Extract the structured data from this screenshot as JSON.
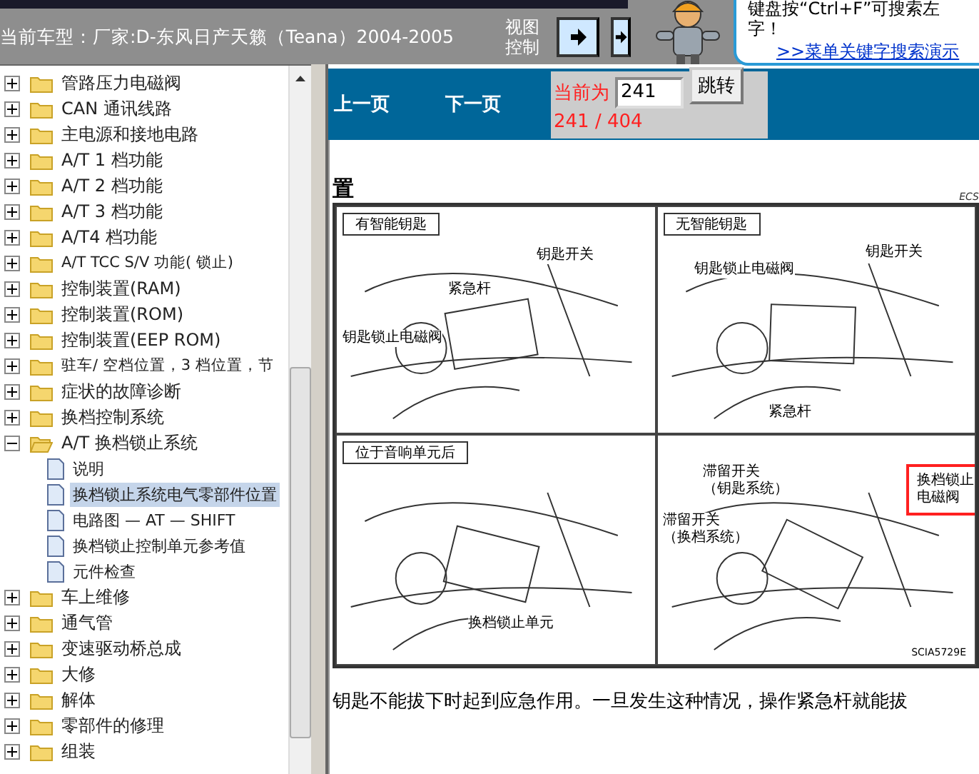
{
  "header": {
    "model_label": "当前车型：厂家:D-东风日产天籁（Teana）2004-2005",
    "view_control": [
      "视图",
      "控制"
    ],
    "tip_text": [
      "键盘按“Ctrl+F”可搜索左",
      "字！"
    ],
    "tip_link": ">>菜单关键字搜索演示"
  },
  "tree": [
    {
      "label": "管路压力电磁阀",
      "expanded": false
    },
    {
      "label": "CAN 通讯线路",
      "expanded": false
    },
    {
      "label": "主电源和接地电路",
      "expanded": false
    },
    {
      "label": "A/T 1 档功能",
      "expanded": false
    },
    {
      "label": "A/T 2 档功能",
      "expanded": false
    },
    {
      "label": "A/T 3 档功能",
      "expanded": false
    },
    {
      "label": "A/T4 档功能",
      "expanded": false
    },
    {
      "label": "A/T TCC S/V 功能( 锁止)",
      "expanded": false
    },
    {
      "label": "控制装置(RAM)",
      "expanded": false
    },
    {
      "label": "控制装置(ROM)",
      "expanded": false
    },
    {
      "label": "控制装置(EEP ROM)",
      "expanded": false
    },
    {
      "label": "驻车/ 空档位置，3 档位置，节",
      "expanded": false
    },
    {
      "label": "症状的故障诊断",
      "expanded": false
    },
    {
      "label": "换档控制系统",
      "expanded": false
    },
    {
      "label": "A/T 换档锁止系统",
      "expanded": true,
      "children": [
        {
          "label": "说明",
          "selected": false
        },
        {
          "label": "换档锁止系统电气零部件位置",
          "selected": true
        },
        {
          "label": "电路图 — AT — SHIFT",
          "selected": false
        },
        {
          "label": "换档锁止控制单元参考值",
          "selected": false
        },
        {
          "label": "元件检查",
          "selected": false
        }
      ]
    },
    {
      "label": "车上维修",
      "expanded": false
    },
    {
      "label": "通气管",
      "expanded": false
    },
    {
      "label": "变速驱动桥总成",
      "expanded": false
    },
    {
      "label": "大修",
      "expanded": false
    },
    {
      "label": "解体",
      "expanded": false
    },
    {
      "label": "零部件的修理",
      "expanded": false
    },
    {
      "label": "组装",
      "expanded": false
    }
  ],
  "toolbar": {
    "prev": "上一页",
    "next": "下一页",
    "current_label": "当前为",
    "page_input": "241",
    "go_button": "跳转",
    "page_count": "241 / 404"
  },
  "document": {
    "heading": "置",
    "figure_code": "ECS",
    "panels": [
      {
        "title": "有智能钥匙",
        "callouts": [
          {
            "text": "钥匙开关",
            "highlighted": false
          },
          {
            "text": "紧急杆",
            "highlighted": false
          },
          {
            "text": "钥匙锁止电磁阀",
            "highlighted": false
          }
        ]
      },
      {
        "title": "无智能钥匙",
        "callouts": [
          {
            "text": "钥匙锁止电磁阀",
            "highlighted": false
          },
          {
            "text": "钥匙开关",
            "highlighted": false
          },
          {
            "text": "紧急杆",
            "highlighted": false
          }
        ]
      },
      {
        "title": "位于音响单元后",
        "callouts": [
          {
            "text": "换档锁止单元",
            "highlighted": false
          }
        ]
      },
      {
        "callouts": [
          {
            "text": [
              "滞留开关",
              "（钥匙系统）"
            ],
            "highlighted": false
          },
          {
            "text": [
              "滞留开关",
              "（换档系统）"
            ],
            "highlighted": false
          },
          {
            "text": [
              "换档锁止",
              "电磁阀"
            ],
            "highlighted": true
          }
        ]
      }
    ],
    "figure_id": "SCIA5729E",
    "body": "钥匙不能拔下时起到应急作用。一旦发生这种情况，操作紧急杆就能拔"
  }
}
